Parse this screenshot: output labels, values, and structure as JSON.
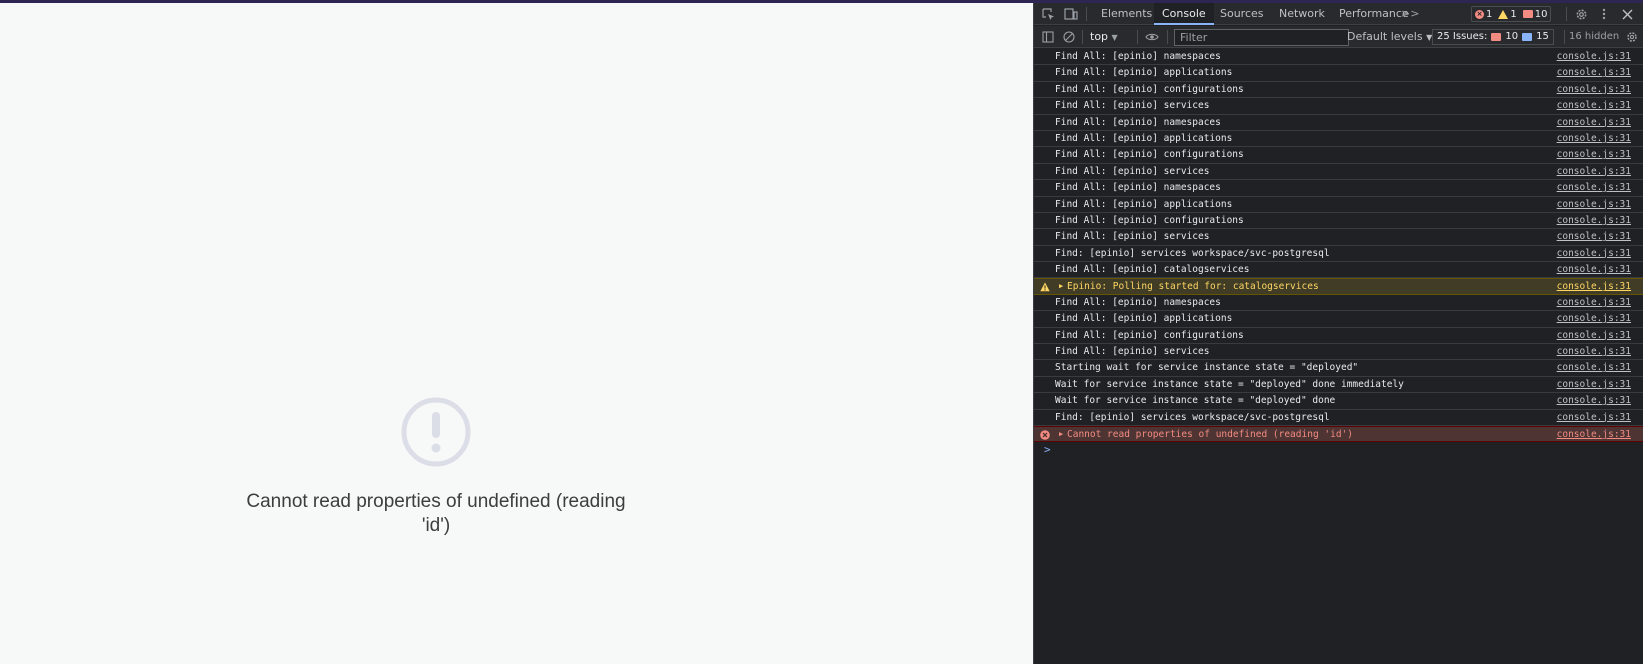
{
  "app": {
    "error_message": "Cannot read properties of undefined (reading 'id')",
    "error_icon": "exclamation-circle-icon"
  },
  "devtools": {
    "tabs": [
      "Elements",
      "Console",
      "Sources",
      "Network",
      "Performance"
    ],
    "more_tabs": ">>",
    "active_tab": "Console",
    "counts": {
      "errors": "1",
      "warnings": "1",
      "issues": "10"
    },
    "toolbar": {
      "context": "top",
      "filter_placeholder": "Filter",
      "levels": "Default levels",
      "issues_label": "25 Issues:",
      "issues_errors": "10",
      "issues_info": "15",
      "hidden": "16 hidden"
    },
    "log": [
      {
        "level": "info",
        "message": "Find All: [epinio] namespaces",
        "source": "console.js:31"
      },
      {
        "level": "info",
        "message": "Find All: [epinio] applications",
        "source": "console.js:31"
      },
      {
        "level": "info",
        "message": "Find All: [epinio] configurations",
        "source": "console.js:31"
      },
      {
        "level": "info",
        "message": "Find All: [epinio] services",
        "source": "console.js:31"
      },
      {
        "level": "info",
        "message": "Find All: [epinio] namespaces",
        "source": "console.js:31"
      },
      {
        "level": "info",
        "message": "Find All: [epinio] applications",
        "source": "console.js:31"
      },
      {
        "level": "info",
        "message": "Find All: [epinio] configurations",
        "source": "console.js:31"
      },
      {
        "level": "info",
        "message": "Find All: [epinio] services",
        "source": "console.js:31"
      },
      {
        "level": "info",
        "message": "Find All: [epinio] namespaces",
        "source": "console.js:31"
      },
      {
        "level": "info",
        "message": "Find All: [epinio] applications",
        "source": "console.js:31"
      },
      {
        "level": "info",
        "message": "Find All: [epinio] configurations",
        "source": "console.js:31"
      },
      {
        "level": "info",
        "message": "Find All: [epinio] services",
        "source": "console.js:31"
      },
      {
        "level": "info",
        "message": "Find: [epinio] services workspace/svc-postgresql",
        "source": "console.js:31"
      },
      {
        "level": "info",
        "message": "Find All: [epinio] catalogservices",
        "source": "console.js:31"
      },
      {
        "level": "warning",
        "message": "Epinio: Polling started for:  catalogservices",
        "source": "console.js:31"
      },
      {
        "level": "info",
        "message": "Find All: [epinio] namespaces",
        "source": "console.js:31"
      },
      {
        "level": "info",
        "message": "Find All: [epinio] applications",
        "source": "console.js:31"
      },
      {
        "level": "info",
        "message": "Find All: [epinio] configurations",
        "source": "console.js:31"
      },
      {
        "level": "info",
        "message": "Find All: [epinio] services",
        "source": "console.js:31"
      },
      {
        "level": "info",
        "message": "Starting wait for service instance state = \"deployed\"",
        "source": "console.js:31"
      },
      {
        "level": "info",
        "message": "Wait for service instance state = \"deployed\" done immediately",
        "source": "console.js:31"
      },
      {
        "level": "info",
        "message": "Wait for service instance state = \"deployed\" done",
        "source": "console.js:31"
      },
      {
        "level": "info",
        "message": "Find: [epinio] services workspace/svc-postgresql",
        "source": "console.js:31"
      },
      {
        "level": "error",
        "message": "Cannot read properties of undefined (reading 'id')",
        "source": "console.js:31"
      }
    ],
    "prompt": ">"
  }
}
